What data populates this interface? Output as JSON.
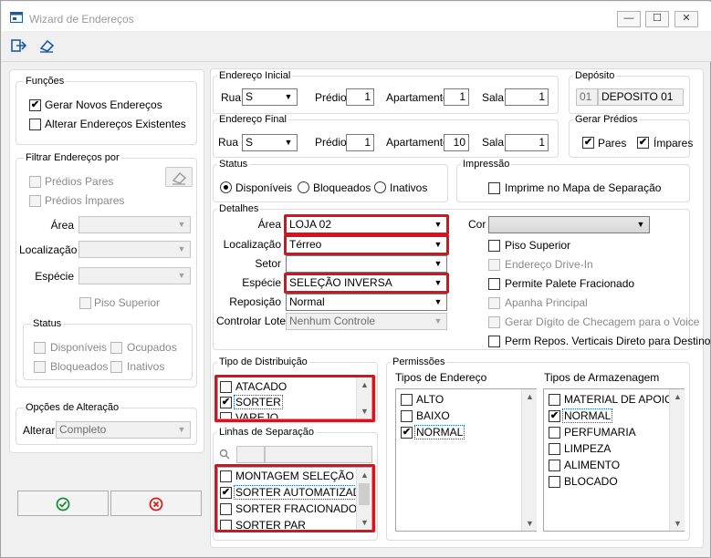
{
  "window": {
    "title": "Wizard de Endereços",
    "minimize": "—",
    "maximize": "☐",
    "close": "✕"
  },
  "toolbar": {
    "exit_icon": "exit-icon",
    "eraser_icon": "eraser-icon"
  },
  "funcoes": {
    "title": "Funções",
    "gerar": "Gerar Novos Endereços",
    "alterar": "Alterar Endereços Existentes"
  },
  "filtrar": {
    "title": "Filtrar Endereços por",
    "pares": "Prédios Pares",
    "impares": "Prédios Ímpares",
    "area": "Área",
    "localizacao": "Localização",
    "especie": "Espécie",
    "piso": "Piso Superior"
  },
  "status_left": {
    "title": "Status",
    "disponiveis": "Disponíveis",
    "ocupados": "Ocupados",
    "bloqueados": "Bloqueados",
    "inativos": "Inativos"
  },
  "opcoes": {
    "title": "Opções de Alteração",
    "alterar_label": "Alterar",
    "alterar_value": "Completo"
  },
  "endereco_inicial": {
    "title": "Endereço Inicial",
    "rua_label": "Rua",
    "rua": "S",
    "predio_label": "Prédio",
    "predio": "1",
    "apto_label": "Apartamento",
    "apto": "1",
    "sala_label": "Sala",
    "sala": "1"
  },
  "endereco_final": {
    "title": "Endereço Final",
    "rua_label": "Rua",
    "rua": "S",
    "predio_label": "Prédio",
    "predio": "1",
    "apto_label": "Apartamento",
    "apto": "10",
    "sala_label": "Sala",
    "sala": "1"
  },
  "deposito": {
    "title": "Depósito",
    "code": "01",
    "name": "DEPOSITO 01"
  },
  "gerar_predios": {
    "title": "Gerar Prédios",
    "pares": "Pares",
    "impares": "Ímpares"
  },
  "status": {
    "title": "Status",
    "disponiveis": "Disponíveis",
    "bloqueados": "Bloqueados",
    "inativos": "Inativos"
  },
  "impressao": {
    "title": "Impressão",
    "imprime": "Imprime no Mapa de Separação"
  },
  "detalhes": {
    "title": "Detalhes",
    "area_label": "Área",
    "area": "LOJA 02",
    "localizacao_label": "Localização",
    "localizacao": "Térreo",
    "setor_label": "Setor",
    "setor": "",
    "especie_label": "Espécie",
    "especie": "SELEÇÃO INVERSA",
    "reposicao_label": "Reposição",
    "reposicao": "Normal",
    "lote_label": "Controlar Lote",
    "lote": "Nenhum Controle",
    "cor_label": "Cor",
    "cor": "",
    "piso": "Piso Superior",
    "drivein": "Endereço Drive-In",
    "palete": "Permite Palete Fracionado",
    "apanha": "Apanha Principal",
    "digito": "Gerar Dígito de Checagem para o Voice",
    "perm": "Perm Repos. Verticais Direto para Destino"
  },
  "distribuicao": {
    "title": "Tipo de Distribuição",
    "items": [
      {
        "label": "ATACADO",
        "checked": false
      },
      {
        "label": "SORTER",
        "checked": true
      },
      {
        "label": "VAREJO",
        "checked": false
      }
    ]
  },
  "linhas": {
    "title": "Linhas de Separação",
    "search_icon": "search-icon",
    "items": [
      {
        "label": "MONTAGEM SELEÇÃO INV",
        "checked": false
      },
      {
        "label": "SORTER AUTOMATIZADO",
        "checked": true
      },
      {
        "label": "SORTER FRACIONADO",
        "checked": false
      },
      {
        "label": "SORTER PAR",
        "checked": false
      }
    ]
  },
  "permissoes": {
    "title": "Permissões",
    "tipos_endereco": "Tipos de Endereço",
    "tipos_armazenagem": "Tipos de Armazenagem",
    "endereco_items": [
      {
        "label": "ALTO",
        "checked": false
      },
      {
        "label": "BAIXO",
        "checked": false
      },
      {
        "label": "NORMAL",
        "checked": true
      }
    ],
    "armazenagem_items": [
      {
        "label": "MATERIAL DE APOIO",
        "checked": false
      },
      {
        "label": "NORMAL",
        "checked": true
      },
      {
        "label": "PERFUMARIA",
        "checked": false
      },
      {
        "label": "LIMPEZA",
        "checked": false
      },
      {
        "label": "ALIMENTO",
        "checked": false
      },
      {
        "label": "BLOCADO",
        "checked": false
      }
    ]
  },
  "buttons": {
    "ok": "✔",
    "cancel": "✖"
  },
  "colors": {
    "highlight": "#e0101a",
    "ok": "#1b8a3a",
    "cancel": "#d32020",
    "accent": "#1a5aa8"
  }
}
